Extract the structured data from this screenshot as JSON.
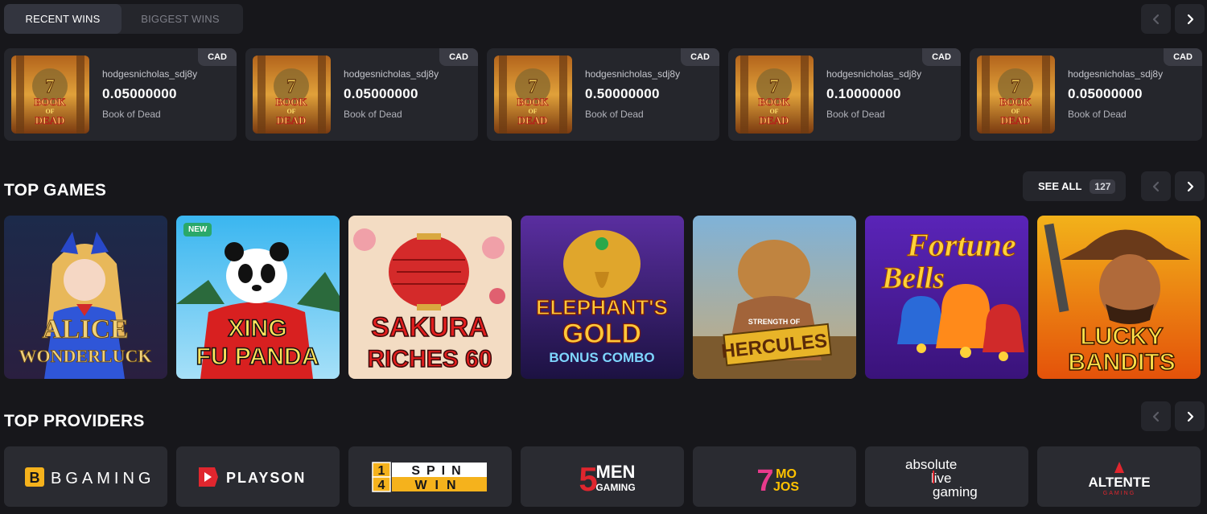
{
  "tabs": [
    {
      "label": "RECENT WINS",
      "active": true
    },
    {
      "label": "BIGGEST WINS",
      "active": false
    }
  ],
  "recent_wins": [
    {
      "user": "hodgesnicholas_sdj8y",
      "amount": "0.05000000",
      "game": "Book of Dead",
      "currency": "CAD"
    },
    {
      "user": "hodgesnicholas_sdj8y",
      "amount": "0.05000000",
      "game": "Book of Dead",
      "currency": "CAD"
    },
    {
      "user": "hodgesnicholas_sdj8y",
      "amount": "0.50000000",
      "game": "Book of Dead",
      "currency": "CAD"
    },
    {
      "user": "hodgesnicholas_sdj8y",
      "amount": "0.10000000",
      "game": "Book of Dead",
      "currency": "CAD"
    },
    {
      "user": "hodgesnicholas_sdj8y",
      "amount": "0.05000000",
      "game": "Book of Dead",
      "currency": "CAD"
    }
  ],
  "thumb_text": {
    "line1": "BOOK",
    "line2": "OF",
    "line3": "DEAD"
  },
  "top_games": {
    "title": "TOP GAMES",
    "see_all_label": "SEE ALL",
    "count": "127",
    "games": [
      {
        "title1": "ALICE",
        "title2": "WONDERLUCK",
        "badge": ""
      },
      {
        "title1": "XING",
        "title2": "FU PANDA",
        "badge": "NEW"
      },
      {
        "title1": "SAKURA",
        "title2": "RICHES 60",
        "badge": ""
      },
      {
        "title1": "ELEPHANT'S",
        "title2": "GOLD",
        "title3": "BONUS COMBO",
        "badge": ""
      },
      {
        "title1": "STRENGTH OF",
        "title2": "HERCULES",
        "badge": ""
      },
      {
        "title1": "Fortune",
        "title2": "Bells",
        "badge": ""
      },
      {
        "title1": "LUCKY",
        "title2": "BANDITS",
        "badge": ""
      }
    ]
  },
  "top_providers": {
    "title": "TOP PROVIDERS",
    "providers": [
      {
        "name": "BGAMING"
      },
      {
        "name": "PLAYSON"
      },
      {
        "name": "1SPIN4WIN",
        "a": "1",
        "b": "4",
        "c": "SPIN",
        "d": "WIN"
      },
      {
        "name": "5MEN GAMING",
        "a": "5",
        "b": "MEN",
        "c": "GAMING"
      },
      {
        "name": "7MOJOS",
        "a": "7",
        "b": "MO",
        "c": "JOS"
      },
      {
        "name": "absolute live gaming",
        "a": "absolute",
        "b": "live",
        "c": "gaming"
      },
      {
        "name": "ALTENTE",
        "sub": "GAMING"
      }
    ]
  },
  "colors": {
    "background": "#17171b",
    "card": "#25262c",
    "accent_green": "#2aa86a"
  }
}
